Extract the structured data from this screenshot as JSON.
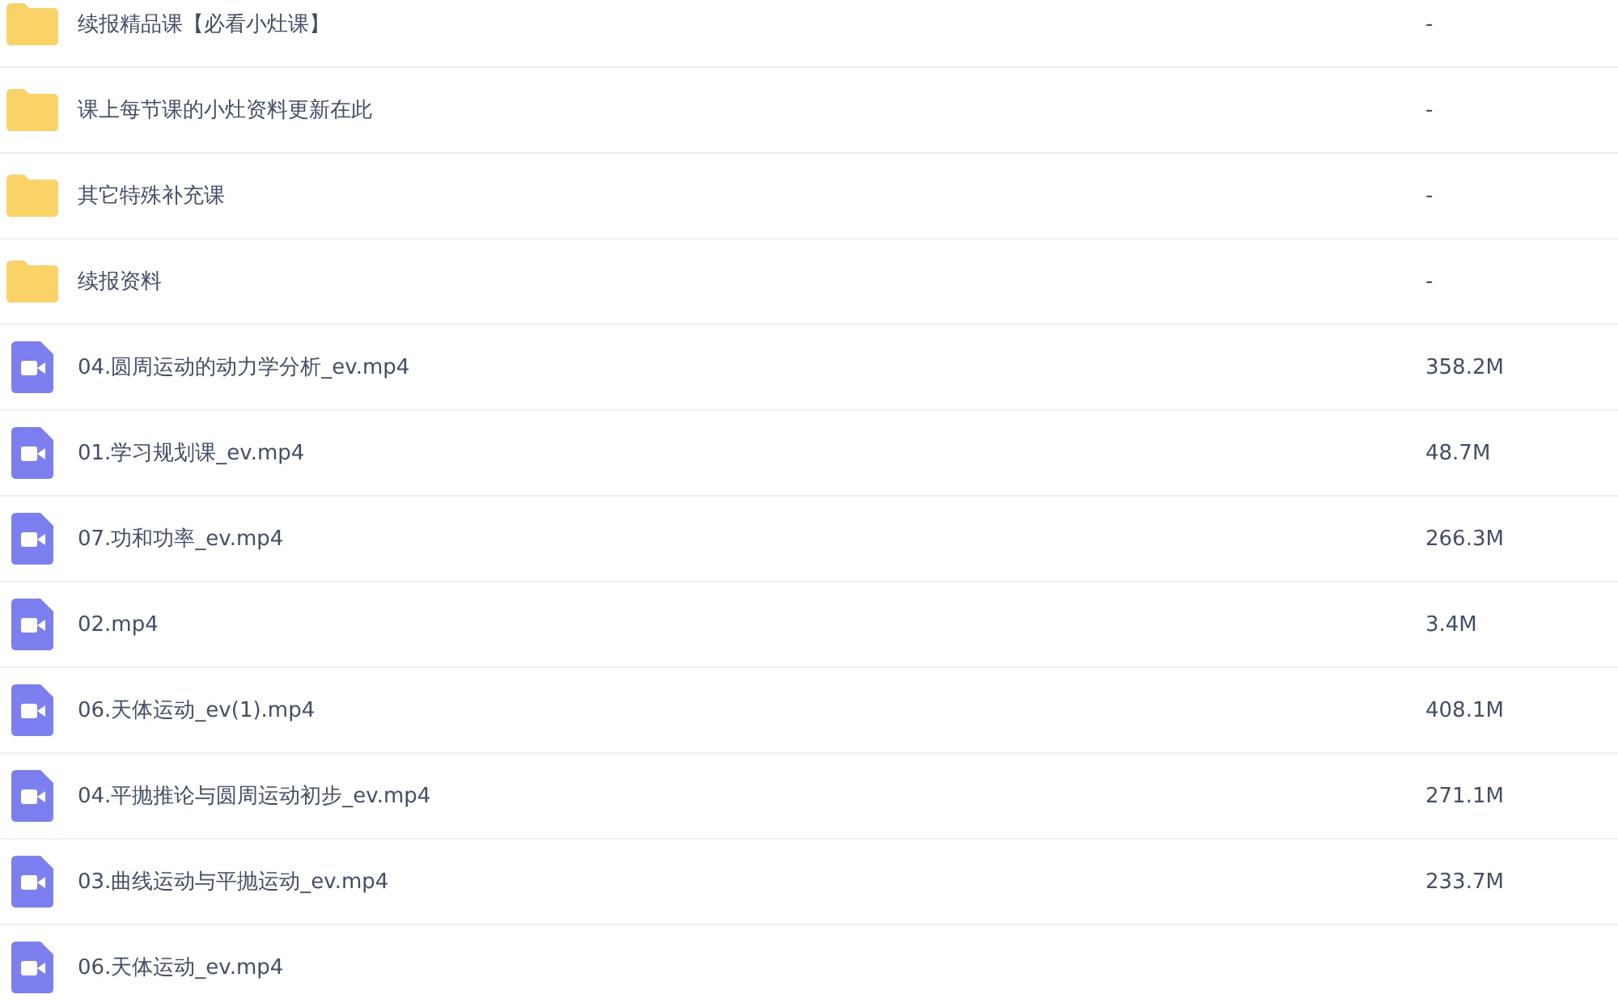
{
  "files": [
    {
      "kind": "folder",
      "name": "续报精品课【必看小灶课】",
      "size": "-"
    },
    {
      "kind": "folder",
      "name": "课上每节课的小灶资料更新在此",
      "size": "-"
    },
    {
      "kind": "folder",
      "name": "其它特殊补充课",
      "size": "-"
    },
    {
      "kind": "folder",
      "name": "续报资料",
      "size": "-"
    },
    {
      "kind": "video",
      "name": "04.圆周运动的动力学分析_ev.mp4",
      "size": "358.2M"
    },
    {
      "kind": "video",
      "name": "01.学习规划课_ev.mp4",
      "size": "48.7M"
    },
    {
      "kind": "video",
      "name": "07.功和功率_ev.mp4",
      "size": "266.3M"
    },
    {
      "kind": "video",
      "name": "02.mp4",
      "size": "3.4M"
    },
    {
      "kind": "video",
      "name": "06.天体运动_ev(1).mp4",
      "size": "408.1M"
    },
    {
      "kind": "video",
      "name": "04.平抛推论与圆周运动初步_ev.mp4",
      "size": "271.1M"
    },
    {
      "kind": "video",
      "name": "03.曲线运动与平抛运动_ev.mp4",
      "size": "233.7M"
    },
    {
      "kind": "video",
      "name": "06.天体运动_ev.mp4"
    }
  ]
}
